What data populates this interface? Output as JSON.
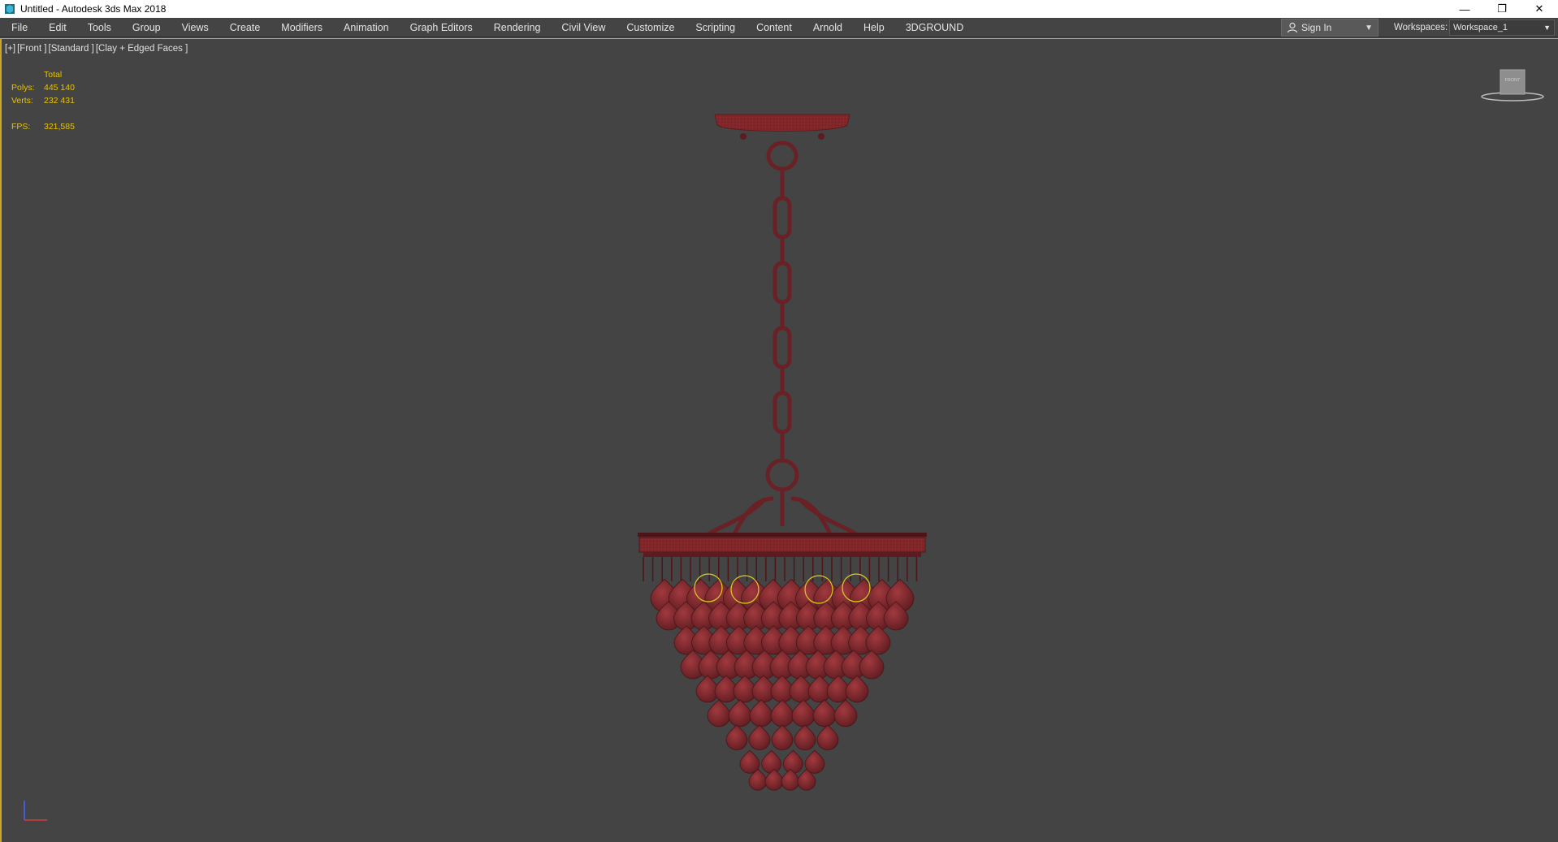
{
  "window": {
    "title": "Untitled - Autodesk 3ds Max 2018",
    "controls": {
      "minimize": "—",
      "restore": "❐",
      "close": "✕"
    }
  },
  "menubar": {
    "items": [
      "File",
      "Edit",
      "Tools",
      "Group",
      "Views",
      "Create",
      "Modifiers",
      "Animation",
      "Graph Editors",
      "Rendering",
      "Civil View",
      "Customize",
      "Scripting",
      "Content",
      "Arnold",
      "Help",
      "3DGROUND"
    ],
    "sign_in": "Sign In",
    "workspaces_label": "Workspaces:",
    "workspace_value": "Workspace_1"
  },
  "viewport": {
    "label_parts": [
      "[+]",
      "[Front ]",
      "[Standard ]",
      "[Clay + Edged Faces ]"
    ],
    "stats": {
      "header": "Total",
      "polys_label": "Polys:",
      "polys_value": "445 140",
      "verts_label": "Verts:",
      "verts_value": "232 431",
      "fps_label": "FPS:",
      "fps_value": "321,585"
    },
    "viewcube_label": "FRONT"
  },
  "colors": {
    "accent": "#c8a826",
    "stats": "#e6c200",
    "model": "#8a2a2e",
    "background": "#444444"
  },
  "icons": {
    "app": "3dsmax-icon",
    "user": "user-icon",
    "dropdown": "chevron-down-icon"
  }
}
